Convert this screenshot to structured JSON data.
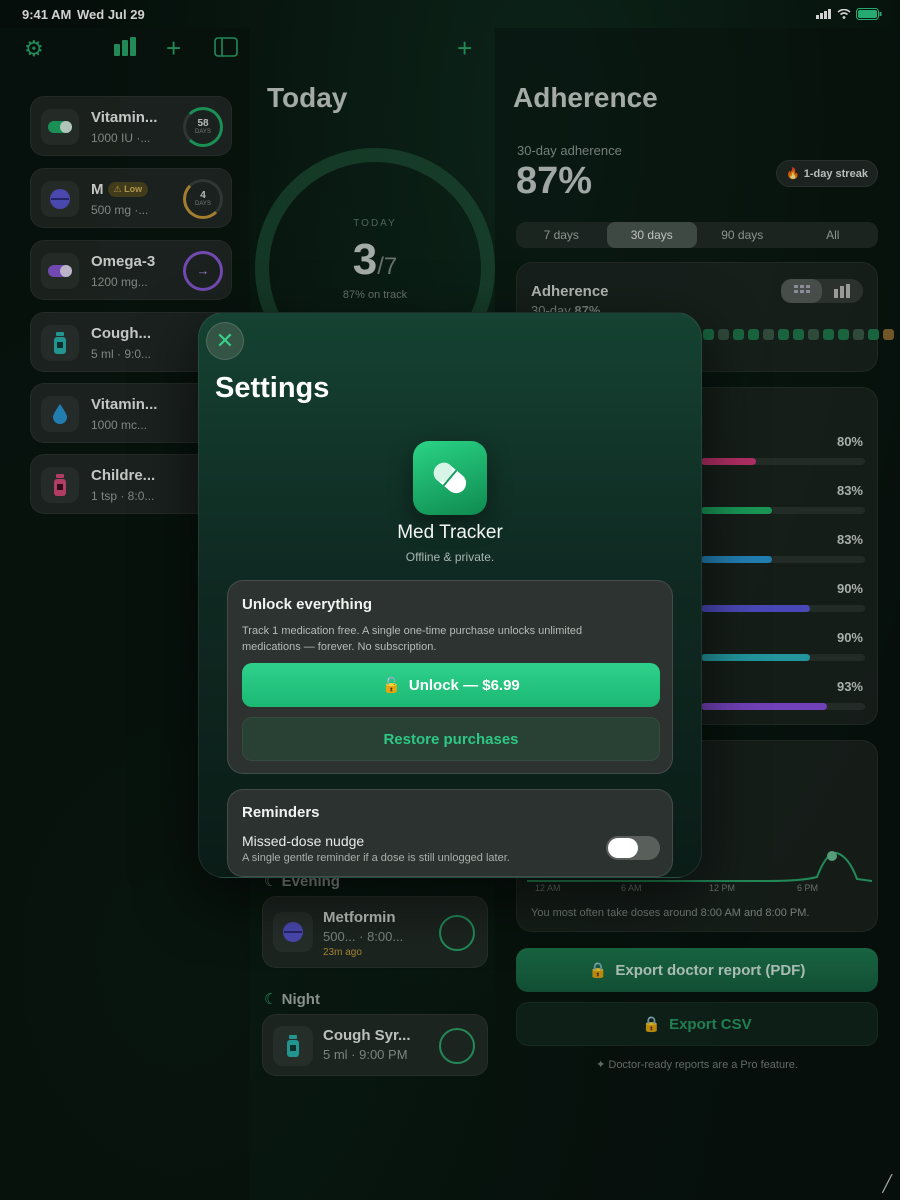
{
  "status_bar": {
    "time": "9:41 AM",
    "date": "Wed Jul 29"
  },
  "sidebar": {
    "meds": [
      {
        "name": "Vitamin...",
        "detail": "1000 IU ·...",
        "ring_value": "58",
        "ring_unit": "DAYS",
        "icon": "pill-capsule-icon",
        "color": "#22b06a"
      },
      {
        "name": "M",
        "badge": "Low",
        "detail": "500 mg ·...",
        "ring_value": "4",
        "ring_unit": "DAYS",
        "icon": "pill-tablet-icon",
        "color": "#5b58d6"
      },
      {
        "name": "Omega-3",
        "detail": "1200 mg...",
        "ring_value": "→",
        "ring_unit": "",
        "icon": "softgel-icon",
        "color": "#8a5ad8"
      },
      {
        "name": "Cough...",
        "detail": "5 ml · 9:0...",
        "ring_value": "",
        "ring_unit": "",
        "icon": "bottle-icon",
        "color": "#2ab6b0"
      },
      {
        "name": "Vitamin...",
        "detail": "1000 mc...",
        "ring_value": "",
        "ring_unit": "",
        "icon": "drop-icon",
        "color": "#2a9ad8"
      },
      {
        "name": "Childre...",
        "detail": "1 tsp · 8:0...",
        "ring_value": "",
        "ring_unit": "",
        "icon": "bottle-icon",
        "color": "#d84a7a"
      }
    ]
  },
  "today": {
    "title": "Today",
    "ring_label": "TODAY",
    "taken": "3",
    "total": "/7",
    "on_track": "87% on track",
    "progress": 0.43,
    "evening_label": "Evening",
    "night_label": "Night",
    "evening_dose": {
      "name": "Metformin",
      "detail": "500... · 8:00...",
      "ago": "23m ago"
    },
    "night_dose": {
      "name": "Cough Syr...",
      "detail": "5 ml · 9:00 PM"
    }
  },
  "adherence": {
    "title": "Adherence",
    "label": "30-day adherence",
    "value": "87%",
    "streak": "1-day streak",
    "ranges": [
      "7 days",
      "30 days",
      "90 days",
      "All"
    ],
    "selected_range": "30 days",
    "panel_title": "Adherence",
    "panel_sub": "30-day",
    "panel_pct": "87%",
    "per_med": [
      {
        "pct": "80%",
        "value": 0.8,
        "color": "#d83a7a"
      },
      {
        "pct": "83%",
        "value": 0.83,
        "color": "#1fb86a"
      },
      {
        "pct": "83%",
        "value": 0.83,
        "color": "#2a9ad8"
      },
      {
        "pct": "90%",
        "value": 0.9,
        "color": "#5a58e0"
      },
      {
        "pct": "90%",
        "value": 0.9,
        "color": "#2ab6c0"
      },
      {
        "pct": "93%",
        "value": 0.93,
        "color": "#8a50e0"
      }
    ],
    "time_ticks": [
      "12 AM",
      "6 AM",
      "12 PM",
      "6 PM"
    ],
    "time_note": "You most often take doses around 8:00 AM and 8:00 PM.",
    "export_pdf": "Export doctor report (PDF)",
    "export_csv": "Export CSV",
    "pro_note": "Doctor-ready reports are a Pro feature."
  },
  "settings": {
    "title": "Settings",
    "app_name": "Med Tracker",
    "app_tagline": "Offline & private.",
    "unlock_title": "Unlock everything",
    "unlock_desc": "Track 1 medication free. A single one-time purchase unlocks unlimited medications — forever. No subscription.",
    "unlock_button": "Unlock — $6.99",
    "restore_button": "Restore purchases",
    "reminders_title": "Reminders",
    "nudge_label": "Missed-dose nudge",
    "nudge_desc": "A single gentle reminder if a dose is still unlogged later.",
    "nudge_enabled": false
  },
  "colors": {
    "accent": "#2ed18b",
    "brand": "#1bb874"
  }
}
